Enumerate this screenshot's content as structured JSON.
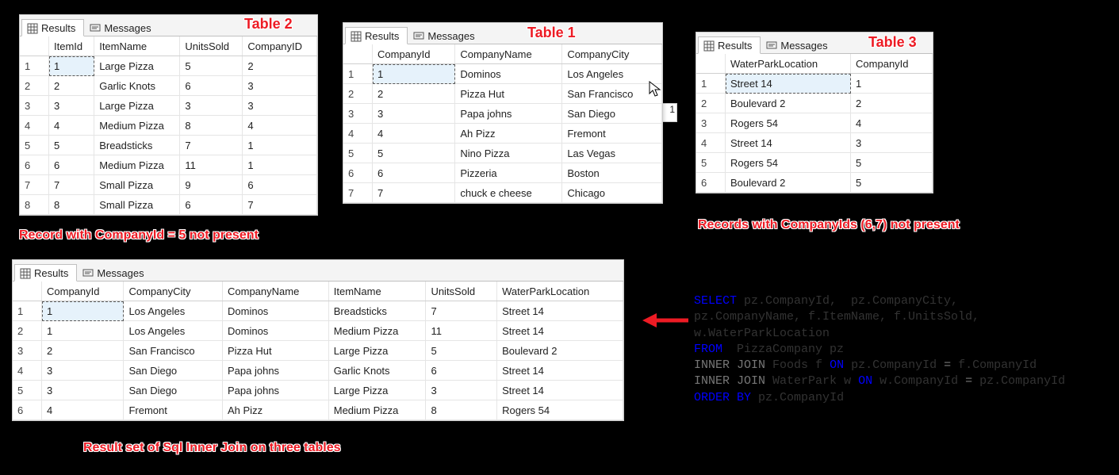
{
  "tabs": {
    "results": "Results",
    "messages": "Messages"
  },
  "labels": {
    "table1": "Table 1",
    "table2": "Table 2",
    "table3": "Table 3",
    "note_t2": "Record with CompanyId = 5 not present",
    "note_t3": "Records with CompanyIds (6,7) not present",
    "note_result": "Result set of Sql Inner Join on three tables"
  },
  "table2": {
    "headers": [
      "",
      "ItemId",
      "ItemName",
      "UnitsSold",
      "CompanyID"
    ],
    "rows": [
      [
        "1",
        "1",
        "Large Pizza",
        "5",
        "2"
      ],
      [
        "2",
        "2",
        "Garlic Knots",
        "6",
        "3"
      ],
      [
        "3",
        "3",
        "Large Pizza",
        "3",
        "3"
      ],
      [
        "4",
        "4",
        "Medium Pizza",
        "8",
        "4"
      ],
      [
        "5",
        "5",
        "Breadsticks",
        "7",
        "1"
      ],
      [
        "6",
        "6",
        "Medium Pizza",
        "11",
        "1"
      ],
      [
        "7",
        "7",
        "Small Pizza",
        "9",
        "6"
      ],
      [
        "8",
        "8",
        "Small Pizza",
        "6",
        "7"
      ]
    ]
  },
  "table1": {
    "headers": [
      "",
      "CompanyId",
      "CompanyName",
      "CompanyCity"
    ],
    "rows": [
      [
        "1",
        "1",
        "Dominos",
        "Los Angeles"
      ],
      [
        "2",
        "2",
        "Pizza Hut",
        "San Francisco"
      ],
      [
        "3",
        "3",
        "Papa johns",
        "San Diego"
      ],
      [
        "4",
        "4",
        "Ah Pizz",
        "Fremont"
      ],
      [
        "5",
        "5",
        "Nino Pizza",
        "Las Vegas"
      ],
      [
        "6",
        "6",
        "Pizzeria",
        "Boston"
      ],
      [
        "7",
        "7",
        "chuck e cheese",
        "Chicago"
      ]
    ]
  },
  "table3": {
    "headers": [
      "",
      "WaterParkLocation",
      "CompanyId"
    ],
    "rows": [
      [
        "1",
        "Street 14",
        "1"
      ],
      [
        "2",
        "Boulevard 2",
        "2"
      ],
      [
        "3",
        "Rogers 54",
        "4"
      ],
      [
        "4",
        "Street 14",
        "3"
      ],
      [
        "5",
        "Rogers 54",
        "5"
      ],
      [
        "6",
        "Boulevard 2",
        "5"
      ]
    ]
  },
  "result": {
    "headers": [
      "",
      "CompanyId",
      "CompanyCity",
      "CompanyName",
      "ItemName",
      "UnitsSold",
      "WaterParkLocation"
    ],
    "rows": [
      [
        "1",
        "1",
        "Los Angeles",
        "Dominos",
        "Breadsticks",
        "7",
        "Street 14"
      ],
      [
        "2",
        "1",
        "Los Angeles",
        "Dominos",
        "Medium Pizza",
        "11",
        "Street 14"
      ],
      [
        "3",
        "2",
        "San Francisco",
        "Pizza Hut",
        "Large Pizza",
        "5",
        "Boulevard 2"
      ],
      [
        "4",
        "3",
        "San Diego",
        "Papa johns",
        "Garlic Knots",
        "6",
        "Street 14"
      ],
      [
        "5",
        "3",
        "San Diego",
        "Papa johns",
        "Large Pizza",
        "3",
        "Street 14"
      ],
      [
        "6",
        "4",
        "Fremont",
        "Ah Pizz",
        "Medium Pizza",
        "8",
        "Rogers 54"
      ]
    ]
  },
  "sql": {
    "l1a": "SELECT",
    "l1b": " pz.CompanyId,  pz.CompanyCity,",
    "l2": "pz.CompanyName, f.ItemName, f.UnitsSold,",
    "l3": "w.WaterParkLocation",
    "l4a": "FROM",
    "l4b": "  PizzaCompany pz",
    "l5a": "INNER",
    "l5b": "JOIN",
    "l5c": " Foods f ",
    "l5d": "ON",
    "l5e": " pz.CompanyId ",
    "l5f": "=",
    "l5g": " f.CompanyId",
    "l6a": "INNER",
    "l6b": "JOIN",
    "l6c": " WaterPark w ",
    "l6d": "ON",
    "l6e": " w.CompanyId ",
    "l6f": "=",
    "l6g": " pz.CompanyId",
    "l7a": "ORDER",
    "l7b": "BY",
    "l7c": " pz.CompanyId"
  }
}
